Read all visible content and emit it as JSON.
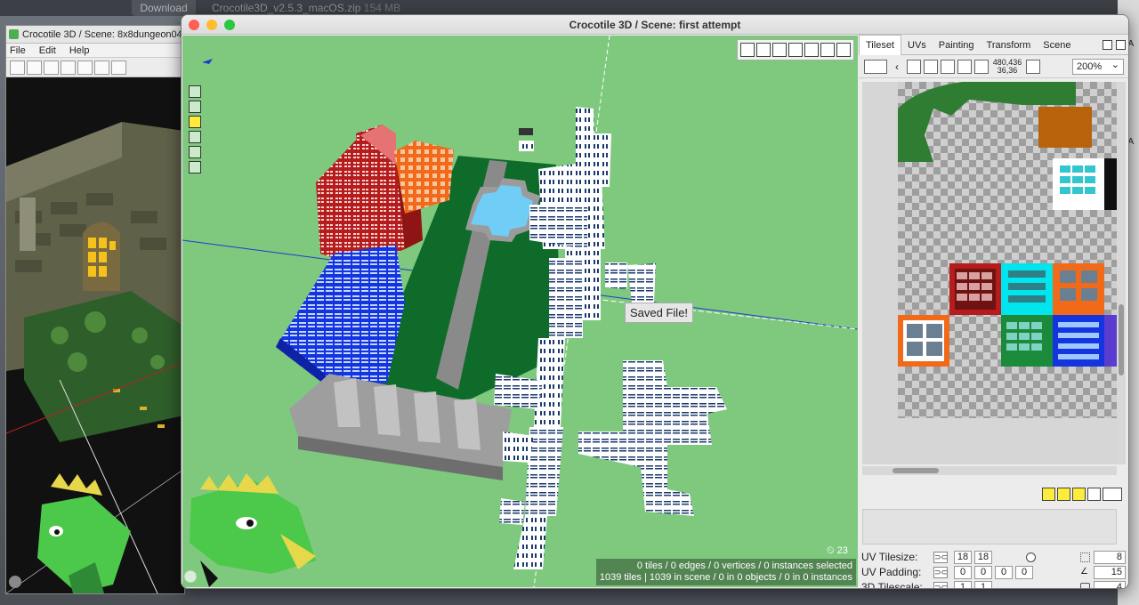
{
  "browser": {
    "download_label": "Download",
    "download_file": "Crocotile3D_v2.5.3_macOS.zip",
    "download_size": "154 MB"
  },
  "left_window": {
    "title": "Crocotile 3D / Scene: 8x8dungeon04",
    "menu": [
      "File",
      "Edit",
      "Help"
    ]
  },
  "main_window": {
    "title": "Crocotile 3D / Scene: first attempt",
    "toast": "Saved File!",
    "tile_count_badge": "23",
    "status_line1": "0 tiles / 0 edges / 0 vertices / 0 instances selected",
    "status_line2": "1039 tiles | 1039 in scene / 0 in 0 objects / 0 in 0 instances"
  },
  "panel": {
    "tabs": [
      "Tileset",
      "UVs",
      "Painting",
      "Transform",
      "Scene"
    ],
    "active_tab": "Tileset",
    "coords_line1": "480,436",
    "coords_line2": "36,36",
    "zoom": "200%",
    "uv_tilesize_label": "UV Tilesize:",
    "uv_tilesize": [
      "18",
      "18"
    ],
    "uv_padding_label": "UV Padding:",
    "uv_padding": [
      "0",
      "0",
      "0",
      "0"
    ],
    "tilescale_label": "3D Tilescale:",
    "tilescale": [
      "1",
      "1"
    ],
    "right_values": [
      "8",
      "15",
      "4"
    ]
  },
  "colors": {
    "viewport_bg": "#7ec97e",
    "red": "#b71c1c",
    "blue": "#1434e0",
    "orange": "#f06a1a",
    "cyan": "#00e5ee",
    "green_tile": "#1b8a3a",
    "water": "#6fcdf6",
    "highlight": "#ffeb3b"
  }
}
